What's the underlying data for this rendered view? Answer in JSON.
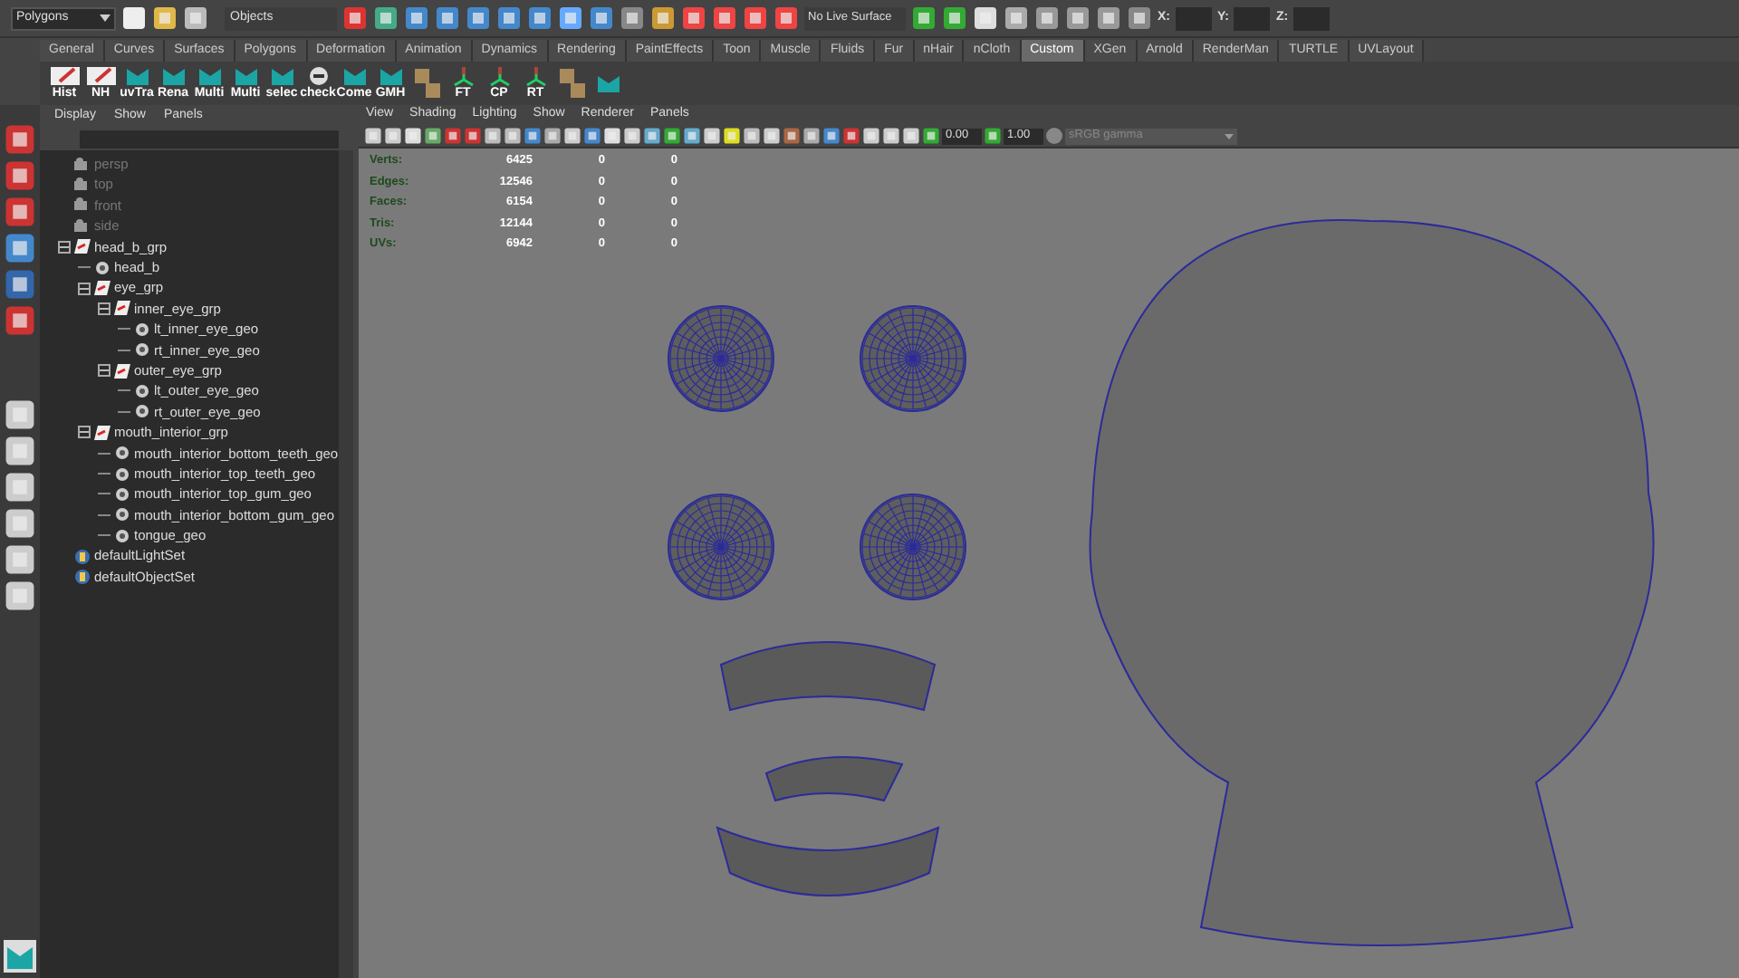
{
  "toolbar": {
    "menu_set": "Polygons",
    "selection_mode": "Objects",
    "live_surface": "No Live Surface",
    "coords": [
      "X:",
      "Y:",
      "Z:"
    ]
  },
  "shelf": {
    "tabs": [
      {
        "label": "General",
        "selected": false
      },
      {
        "label": "Curves",
        "selected": false
      },
      {
        "label": "Surfaces",
        "selected": false
      },
      {
        "label": "Polygons",
        "selected": false
      },
      {
        "label": "Deformation",
        "selected": false
      },
      {
        "label": "Animation",
        "selected": false
      },
      {
        "label": "Dynamics",
        "selected": false
      },
      {
        "label": "Rendering",
        "selected": false
      },
      {
        "label": "PaintEffects",
        "selected": false
      },
      {
        "label": "Toon",
        "selected": false
      },
      {
        "label": "Muscle",
        "selected": false
      },
      {
        "label": "Fluids",
        "selected": false
      },
      {
        "label": "Fur",
        "selected": false
      },
      {
        "label": "nHair",
        "selected": false
      },
      {
        "label": "nCloth",
        "selected": false
      },
      {
        "label": "Custom",
        "selected": true
      },
      {
        "label": "XGen",
        "selected": false
      },
      {
        "label": "Arnold",
        "selected": false
      },
      {
        "label": "RenderMan",
        "selected": false
      },
      {
        "label": "TURTLE",
        "selected": false
      },
      {
        "label": "UVLayout",
        "selected": false
      }
    ],
    "buttons": [
      {
        "kind": "note",
        "label": "Hist"
      },
      {
        "kind": "note",
        "label": "NH"
      },
      {
        "kind": "maya",
        "label": "uvTra"
      },
      {
        "kind": "maya",
        "label": "Rena"
      },
      {
        "kind": "maya",
        "label": "Multi"
      },
      {
        "kind": "maya",
        "label": "Multi"
      },
      {
        "kind": "maya",
        "label": "selec"
      },
      {
        "kind": "python",
        "label": "check"
      },
      {
        "kind": "maya",
        "label": "Come"
      },
      {
        "kind": "maya",
        "label": "GMH"
      },
      {
        "kind": "tool"
      },
      {
        "kind": "axes",
        "label": "FT"
      },
      {
        "kind": "axes",
        "label": "CP"
      },
      {
        "kind": "axes",
        "label": "RT"
      },
      {
        "kind": "tool"
      },
      {
        "kind": "maya"
      }
    ]
  },
  "outliner": {
    "menus": [
      "Display",
      "Show",
      "Panels"
    ],
    "items": [
      {
        "kind": "camera",
        "label": "persp",
        "dimmed": true
      },
      {
        "kind": "camera",
        "label": "top",
        "dimmed": true
      },
      {
        "kind": "camera",
        "label": "front",
        "dimmed": true
      },
      {
        "kind": "camera",
        "label": "side",
        "dimmed": true
      },
      {
        "kind": "group",
        "label": "head_b_grp",
        "expanded": true,
        "children": [
          {
            "kind": "mesh",
            "label": "head_b"
          },
          {
            "kind": "group",
            "label": "eye_grp",
            "expanded": true,
            "children": [
              {
                "kind": "group",
                "label": "inner_eye_grp",
                "expanded": true,
                "children": [
                  {
                    "kind": "mesh",
                    "label": "lt_inner_eye_geo"
                  },
                  {
                    "kind": "mesh",
                    "label": "rt_inner_eye_geo"
                  }
                ]
              },
              {
                "kind": "group",
                "label": "outer_eye_grp",
                "expanded": true,
                "children": [
                  {
                    "kind": "mesh",
                    "label": "lt_outer_eye_geo"
                  },
                  {
                    "kind": "mesh",
                    "label": "rt_outer_eye_geo"
                  }
                ]
              }
            ]
          },
          {
            "kind": "group",
            "label": "mouth_interior_grp",
            "expanded": true,
            "children": [
              {
                "kind": "mesh",
                "label": "mouth_interior_bottom_teeth_geo"
              },
              {
                "kind": "mesh",
                "label": "mouth_interior_top_teeth_geo"
              },
              {
                "kind": "mesh",
                "label": "mouth_interior_top_gum_geo"
              },
              {
                "kind": "mesh",
                "label": "mouth_interior_bottom_gum_geo"
              },
              {
                "kind": "mesh",
                "label": "tongue_geo"
              }
            ]
          }
        ]
      },
      {
        "kind": "set",
        "label": "defaultLightSet"
      },
      {
        "kind": "set",
        "label": "defaultObjectSet"
      }
    ]
  },
  "viewport": {
    "menus": [
      "View",
      "Shading",
      "Lighting",
      "Show",
      "Renderer",
      "Panels"
    ],
    "exposure": "0.00",
    "gamma": "1.00",
    "color_space": "sRGB gamma",
    "stats": [
      {
        "label": "Verts:",
        "values": [
          "6425",
          "0",
          "0"
        ]
      },
      {
        "label": "Edges:",
        "values": [
          "12546",
          "0",
          "0"
        ]
      },
      {
        "label": "Faces:",
        "values": [
          "6154",
          "0",
          "0"
        ]
      },
      {
        "label": "Tris:",
        "values": [
          "12144",
          "0",
          "0"
        ]
      },
      {
        "label": "UVs:",
        "values": [
          "6942",
          "0",
          "0"
        ]
      }
    ]
  }
}
